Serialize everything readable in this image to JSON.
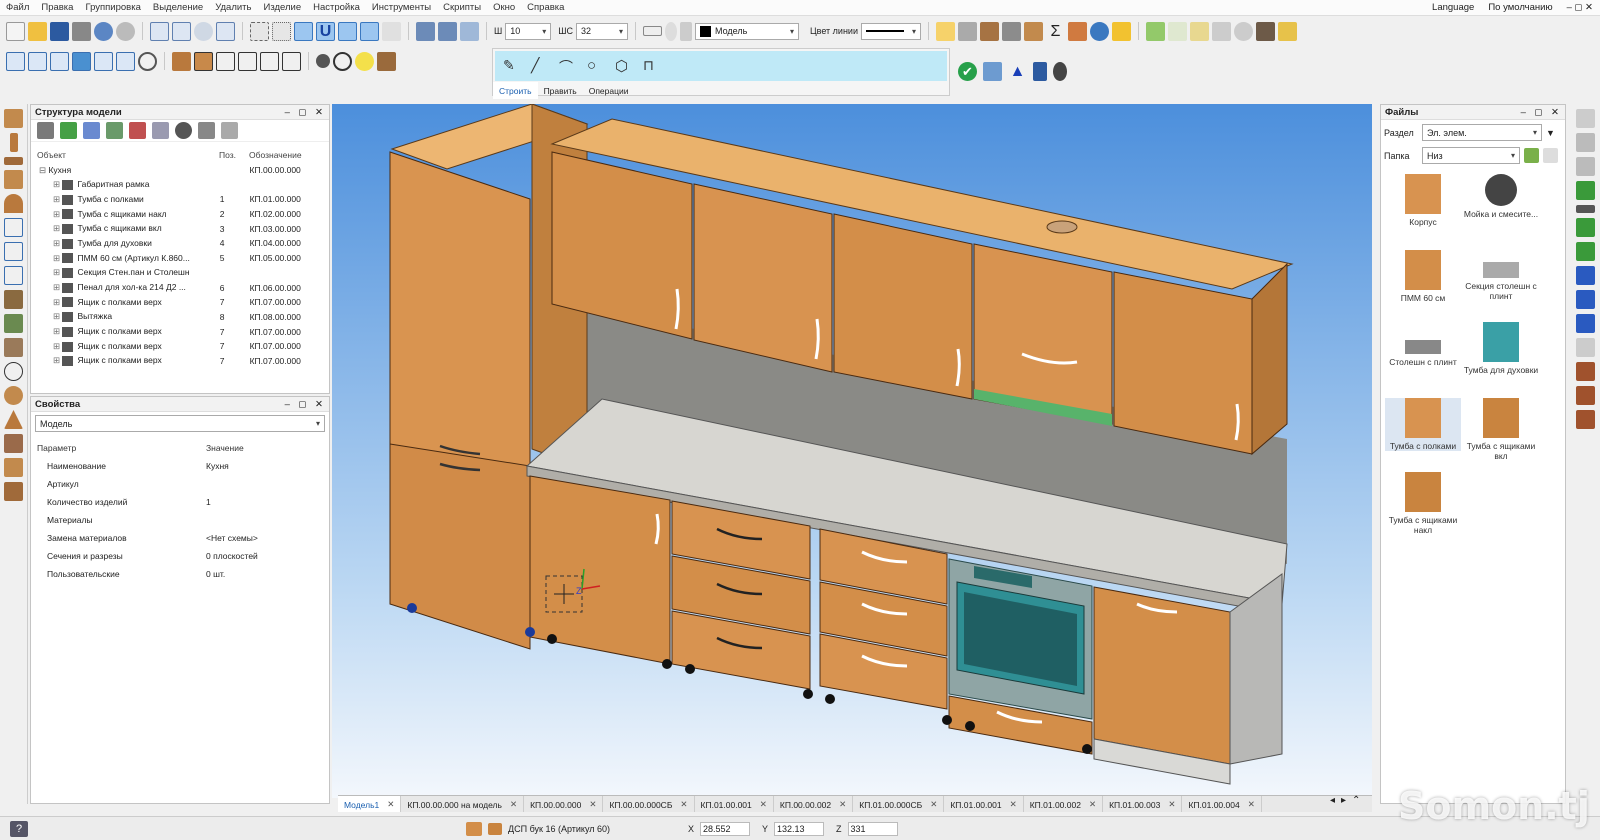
{
  "menu": [
    "Файл",
    "Правка",
    "Группировка",
    "Выделение",
    "Удалить",
    "Изделие",
    "Настройка",
    "Инструменты",
    "Скрипты",
    "Окно",
    "Справка"
  ],
  "menu_right": {
    "language": "Language",
    "default": "По умолчанию",
    "window_controls": "– ◻ ✕"
  },
  "toolbar": {
    "line_width_label": "Ш",
    "line_width_value": "10",
    "step_label": "ШС",
    "step_value": "32",
    "layer_value": "Модель",
    "line_color_label": "Цвет линии"
  },
  "construct_panel": {
    "tabs": [
      "Строить",
      "Править",
      "Операции"
    ]
  },
  "structure": {
    "title": "Структура модели",
    "headers": {
      "object": "Объект",
      "pos": "Поз.",
      "designation": "Обозначение"
    },
    "root": {
      "name": "Кухня",
      "pos": "",
      "code": "КП.00.00.000"
    },
    "items": [
      {
        "name": "Габаритная рамка",
        "pos": "",
        "code": ""
      },
      {
        "name": "Тумба с полками",
        "pos": "1",
        "code": "КП.01.00.000"
      },
      {
        "name": "Тумба с ящиками накл",
        "pos": "2",
        "code": "КП.02.00.000"
      },
      {
        "name": "Тумба с ящиками вкл",
        "pos": "3",
        "code": "КП.03.00.000"
      },
      {
        "name": "Тумба для духовки",
        "pos": "4",
        "code": "КП.04.00.000"
      },
      {
        "name": "ПММ 60 см (Артикул К.860...",
        "pos": "5",
        "code": "КП.05.00.000"
      },
      {
        "name": "Секция Стен.пан и Столешн",
        "pos": "",
        "code": ""
      },
      {
        "name": "Пенал для хол-ка 214 Д2 ...",
        "pos": "6",
        "code": "КП.06.00.000"
      },
      {
        "name": "Ящик с полками верх",
        "pos": "7",
        "code": "КП.07.00.000"
      },
      {
        "name": "Вытяжка",
        "pos": "8",
        "code": "КП.08.00.000"
      },
      {
        "name": "Ящик с полками верх",
        "pos": "7",
        "code": "КП.07.00.000"
      },
      {
        "name": "Ящик с полками верх",
        "pos": "7",
        "code": "КП.07.00.000"
      },
      {
        "name": "Ящик с полками верх",
        "pos": "7",
        "code": "КП.07.00.000"
      }
    ]
  },
  "properties": {
    "title": "Свойства",
    "selector": "Модель",
    "headers": {
      "param": "Параметр",
      "value": "Значение"
    },
    "rows": [
      {
        "k": "Наименование",
        "v": "Кухня"
      },
      {
        "k": "Артикул",
        "v": ""
      },
      {
        "k": "Количество изделий",
        "v": "1"
      },
      {
        "k": "Материалы",
        "v": ""
      },
      {
        "k": "Замена материалов",
        "v": "<Нет схемы>"
      },
      {
        "k": "Сечения и разрезы",
        "v": "0 плоскостей"
      },
      {
        "k": "Пользовательские",
        "v": "0 шт."
      }
    ]
  },
  "files": {
    "title": "Файлы",
    "section_label": "Раздел",
    "section_value": "Эл. элем.",
    "folder_label": "Папка",
    "folder_value": "Низ",
    "items": [
      "Корпус",
      "Мойка и смесите...",
      "ПММ 60 см",
      "Секция столешн с плинт",
      "Столешн с плинт",
      "Тумба для духовки",
      "Тумба с полками",
      "Тумба с ящиками вкл",
      "Тумба с ящиками накл"
    ]
  },
  "doc_tabs": [
    "Модель1",
    "КП.00.00.000 на модель",
    "КП.00.00.000",
    "КП.00.00.000СБ",
    "КП.01.00.001",
    "КП.00.00.002",
    "КП.01.00.000СБ",
    "КП.01.00.001",
    "КП.01.00.002",
    "КП.01.00.003",
    "КП.01.00.004"
  ],
  "status": {
    "material": "ДСП бук 16 (Артикул 60)",
    "x_label": "X",
    "x": "28.552",
    "y_label": "Y",
    "y": "132.13",
    "z_label": "Z",
    "z": "331"
  },
  "watermark": "Somon.tj",
  "colors": {
    "wood": "#d18e4a",
    "wood_light": "#e5a864",
    "viewport": "#6aa6e4",
    "counter": "#cfcfcb",
    "oven": "#3aa0a6"
  }
}
